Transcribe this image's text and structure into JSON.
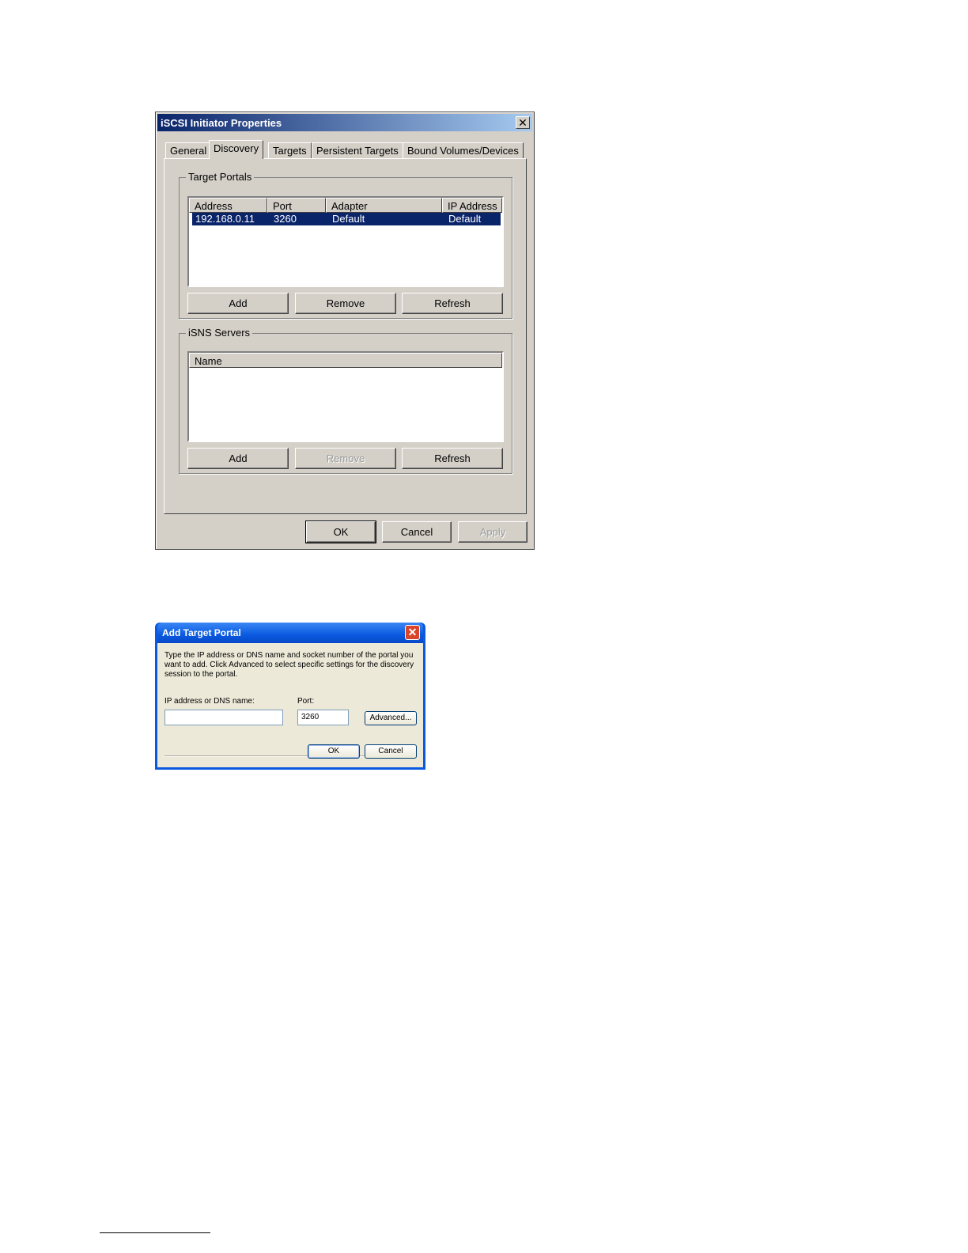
{
  "iscsi_dialog": {
    "title": "iSCSI Initiator Properties",
    "close_glyph": "✕",
    "tabs": [
      "General",
      "Discovery",
      "Targets",
      "Persistent Targets",
      "Bound Volumes/Devices"
    ],
    "target_portals": {
      "legend": "Target Portals",
      "columns": [
        "Address",
        "Port",
        "Adapter",
        "IP Address"
      ],
      "row": {
        "address": "192.168.0.11",
        "port": "3260",
        "adapter": "Default",
        "ip": "Default"
      },
      "buttons": {
        "add": "Add",
        "remove": "Remove",
        "refresh": "Refresh"
      }
    },
    "isns_servers": {
      "legend": "iSNS Servers",
      "columns": [
        "Name"
      ],
      "buttons": {
        "add": "Add",
        "remove": "Remove",
        "refresh": "Refresh"
      }
    },
    "footer": {
      "ok": "OK",
      "cancel": "Cancel",
      "apply": "Apply"
    }
  },
  "add_portal_dialog": {
    "title": "Add Target Portal",
    "close_glyph": "✕",
    "description": "Type the IP address or DNS name and socket number of the portal you want to add. Click Advanced to select specific settings for the discovery session to the portal.",
    "ip_label": "IP address or DNS name:",
    "ip_value": "",
    "port_label": "Port:",
    "port_value": "3260",
    "advanced": "Advanced...",
    "ok": "OK",
    "cancel": "Cancel"
  }
}
